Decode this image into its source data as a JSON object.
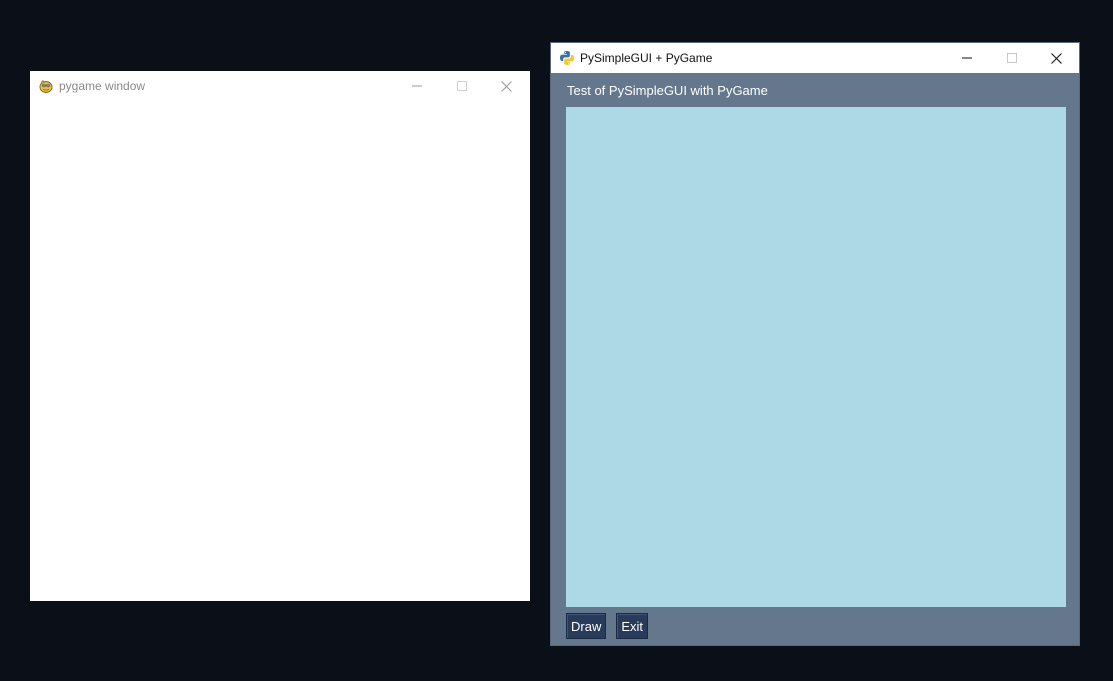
{
  "pygame_window": {
    "title": "pygame window",
    "icon": "pygame-snake-icon",
    "surface_color": "#ffffff"
  },
  "psg_window": {
    "title": "PySimpleGUI + PyGame",
    "icon": "python-logo-icon",
    "background_color": "#64778d",
    "label": "Test of PySimpleGUI with PyGame",
    "graph_color": "#add8e6",
    "buttons": {
      "draw_label": "Draw",
      "exit_label": "Exit"
    },
    "button_color": "#283b5b"
  },
  "desktop_color": "#0b0f17"
}
